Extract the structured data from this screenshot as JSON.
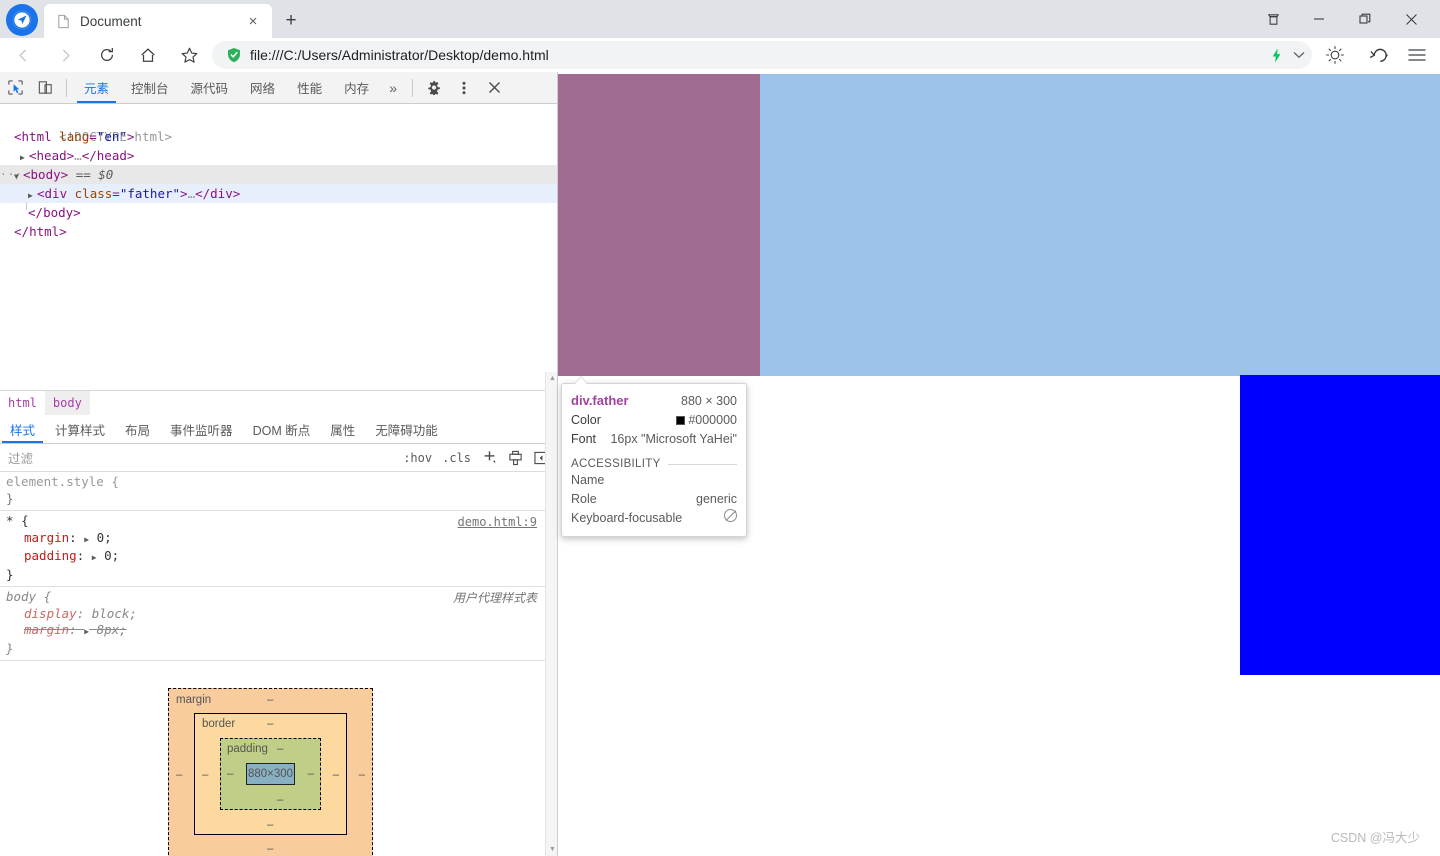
{
  "browser": {
    "tab": {
      "title": "Document",
      "favicon": "page-icon",
      "close": "×"
    },
    "new_tab_label": "+",
    "window_controls": {
      "collection": "collections-icon",
      "minimize": "—",
      "maximize": "❐",
      "close": "✕"
    },
    "nav": {
      "back": "‹",
      "forward": "›",
      "reload": "⟳",
      "home": "⌂",
      "bookmark": "☆"
    },
    "omnibox": {
      "url": "file:///C:/Users/Administrator/Desktop/demo.html",
      "shield_icon": "security-shield-icon",
      "flash_icon": "flash-icon",
      "chevron": "⌄"
    },
    "toolbar": {
      "theme": "sun-icon",
      "undo": "undo-icon",
      "menu": "hamburger-menu-icon"
    }
  },
  "devtools": {
    "toolbar": {
      "inspect": "inspect-element-icon",
      "device": "device-toolbar-icon",
      "tabs": [
        {
          "label": "元素",
          "active": true
        },
        {
          "label": "控制台",
          "active": false
        },
        {
          "label": "源代码",
          "active": false
        },
        {
          "label": "网络",
          "active": false
        },
        {
          "label": "性能",
          "active": false
        },
        {
          "label": "内存",
          "active": false
        }
      ],
      "more": "»",
      "settings": "gear-icon",
      "kebab": "⋮",
      "close": "✕"
    },
    "dom": {
      "lines": [
        {
          "indent": 1,
          "text": "<!DOCTYPE html>",
          "kind": "doctype"
        },
        {
          "indent": 1,
          "text": "<html lang=\"en\">",
          "kind": "open"
        },
        {
          "indent": 1,
          "text": "<head>…</head>",
          "kind": "collapsed"
        },
        {
          "indent": 0,
          "text": "<body> == $0",
          "kind": "selected"
        },
        {
          "indent": 2,
          "text": "<div class=\"father\">…</div>",
          "kind": "child-selected"
        },
        {
          "indent": 1,
          "text": "</body>",
          "kind": "close"
        },
        {
          "indent": 0,
          "text": "</html>",
          "kind": "close"
        }
      ],
      "doctype": "<!DOCTYPE html>",
      "html_open_tag": "html",
      "html_attr_name": "lang",
      "html_attr_value": "\"en\"",
      "head_tag": "head",
      "body_tag": "body",
      "body_marker": "== $0",
      "div_tag": "div",
      "div_attr_name": "class",
      "div_attr_value": "\"father\"",
      "ellipsis": "…"
    },
    "breadcrumbs": [
      {
        "label": "html",
        "active": false
      },
      {
        "label": "body",
        "active": true
      }
    ],
    "sidebar_tabs": [
      {
        "label": "样式",
        "active": true
      },
      {
        "label": "计算样式",
        "active": false
      },
      {
        "label": "布局",
        "active": false
      },
      {
        "label": "事件监听器",
        "active": false
      },
      {
        "label": "DOM 断点",
        "active": false
      },
      {
        "label": "属性",
        "active": false
      },
      {
        "label": "无障碍功能",
        "active": false
      }
    ],
    "filter": {
      "placeholder": "过滤",
      "value": "",
      "hov": ":hov",
      "cls": ".cls",
      "new_rule": "+",
      "print_media": "print-media-icon",
      "toggle_pane": "toggle-pane-icon"
    },
    "rules": [
      {
        "selector": "element.style",
        "open": "{",
        "close": "}",
        "source": "",
        "source_kind": "none",
        "declarations": []
      },
      {
        "selector": "*",
        "open": "{",
        "close": "}",
        "source": "demo.html:9",
        "source_kind": "link",
        "declarations": [
          {
            "name": "margin",
            "value": "0",
            "expandable": true,
            "struck": false
          },
          {
            "name": "padding",
            "value": "0",
            "expandable": true,
            "struck": false
          }
        ]
      },
      {
        "selector": "body",
        "open": "{",
        "close": "}",
        "source": "用户代理样式表",
        "source_kind": "ua",
        "declarations": [
          {
            "name": "display",
            "value": "block",
            "expandable": false,
            "struck": false
          },
          {
            "name": "margin",
            "value": "8px",
            "expandable": true,
            "struck": true
          }
        ]
      }
    ],
    "box_model": {
      "margin_label": "margin",
      "border_label": "border",
      "padding_label": "padding",
      "content_label": "880×300",
      "dash": "–",
      "colors": {
        "margin": "#f9cc9d",
        "border": "#fdd9a0",
        "padding": "#c0cf87",
        "content": "#87b0c3"
      }
    },
    "scrollbars": {
      "up_arrow": "▲",
      "down_arrow": "▼"
    }
  },
  "tooltip": {
    "selector": "div.father",
    "dimensions": "880 × 300",
    "color_label": "Color",
    "color_value": "#000000",
    "color_swatch": "#000000",
    "font_label": "Font",
    "font_value": "16px \"Microsoft YaHei\"",
    "accessibility_label": "ACCESSIBILITY",
    "name_label": "Name",
    "name_value": "",
    "role_label": "Role",
    "role_value": "generic",
    "focusable_label": "Keyboard-focusable",
    "focusable_value": "not-focusable-icon"
  },
  "page_content": {
    "father_color": "#9dc3ea",
    "child_purple_color": "#a06d91",
    "child_blue_color": "#0000ff"
  },
  "watermark": "CSDN @冯大少"
}
